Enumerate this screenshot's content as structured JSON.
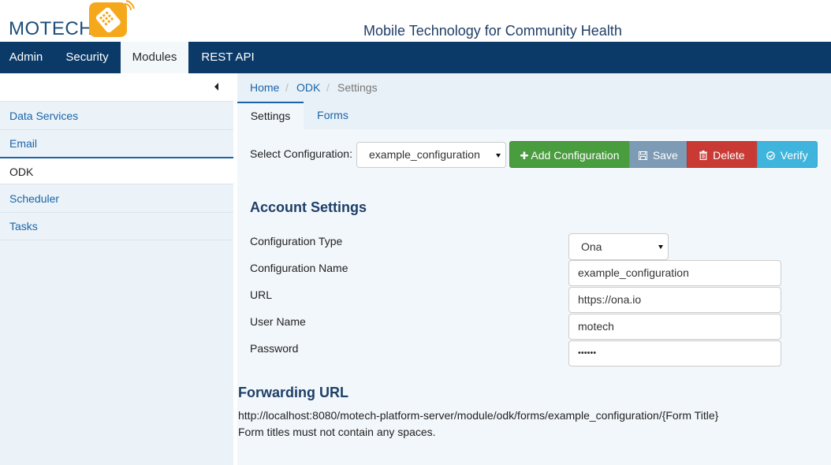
{
  "header": {
    "logo_text": "MOTECH",
    "tagline": "Mobile Technology for Community Health"
  },
  "nav": {
    "items": [
      {
        "label": "Admin"
      },
      {
        "label": "Security"
      },
      {
        "label": "Modules",
        "active": true
      },
      {
        "label": "REST API"
      }
    ]
  },
  "sidebar": {
    "toggle_icon": "caret-left-icon",
    "items": [
      {
        "label": "Data Services"
      },
      {
        "label": "Email"
      },
      {
        "label": "ODK",
        "active": true
      },
      {
        "label": "Scheduler"
      },
      {
        "label": "Tasks"
      }
    ]
  },
  "breadcrumb": {
    "home": "Home",
    "module": "ODK",
    "current": "Settings",
    "separator": "/"
  },
  "tabs": [
    {
      "label": "Settings",
      "active": true
    },
    {
      "label": "Forms"
    }
  ],
  "config_bar": {
    "label": "Select Configuration:",
    "selected": "example_configuration",
    "add_label": "Add Configuration",
    "save_label": "Save",
    "delete_label": "Delete",
    "verify_label": "Verify"
  },
  "account": {
    "title": "Account Settings",
    "type_label": "Configuration Type",
    "type_value": "Ona",
    "name_label": "Configuration Name",
    "name_value": "example_configuration",
    "url_label": "URL",
    "url_value": "https://ona.io",
    "user_label": "User Name",
    "user_value": "motech",
    "password_label": "Password",
    "password_value": "••••••"
  },
  "forwarding": {
    "title": "Forwarding URL",
    "url": "http://localhost:8080/motech-platform-server/module/odk/forms/example_configuration/{Form Title}",
    "note": "Form titles must not contain any spaces."
  },
  "colors": {
    "navbar": "#0b3a68",
    "link": "#1a64a8",
    "success": "#4a9d3f",
    "danger": "#c93a35",
    "info": "#3fb4dc",
    "save": "#7d9bb5"
  }
}
